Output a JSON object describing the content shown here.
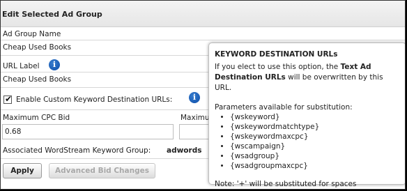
{
  "header": {
    "title": "Edit Selected Ad Group"
  },
  "form": {
    "ad_group_name_label": "Ad Group Name",
    "ad_group_name_value": "Cheap Used Books",
    "url_label_label": "URL Label",
    "url_label_value": "Cheap Used Books",
    "enable_custom_label": "Enable Custom Keyword Destination URLs:",
    "enable_custom_checked": true,
    "max_cpc_label": "Maximum CPC Bid",
    "max_cpc_value": "0.68",
    "max_second_label": "Maximu",
    "associated_label": "Associated WordStream Keyword Group:",
    "associated_value": "adwords"
  },
  "buttons": {
    "apply": "Apply",
    "advanced": "Advanced Bid Changes"
  },
  "tooltip": {
    "title": "KEYWORD DESTINATION URLs",
    "desc_prefix": "If you elect to use this option, the ",
    "desc_bold": "Text Ad Destination URLs",
    "desc_suffix": " will be overwritten by this URL.",
    "params_label": "Parameters available for substitution:",
    "params": [
      "{wskeyword}",
      "{wskeywordmatchtype}",
      "{wskeywordmaxcpc}",
      "{wscampaign}",
      "{wsadgroup}",
      "{wsadgroupmaxcpc}"
    ],
    "note": "Note: '+' will be substituted for spaces"
  },
  "icons": {
    "info": "info-icon",
    "check": "checkmark-icon"
  }
}
